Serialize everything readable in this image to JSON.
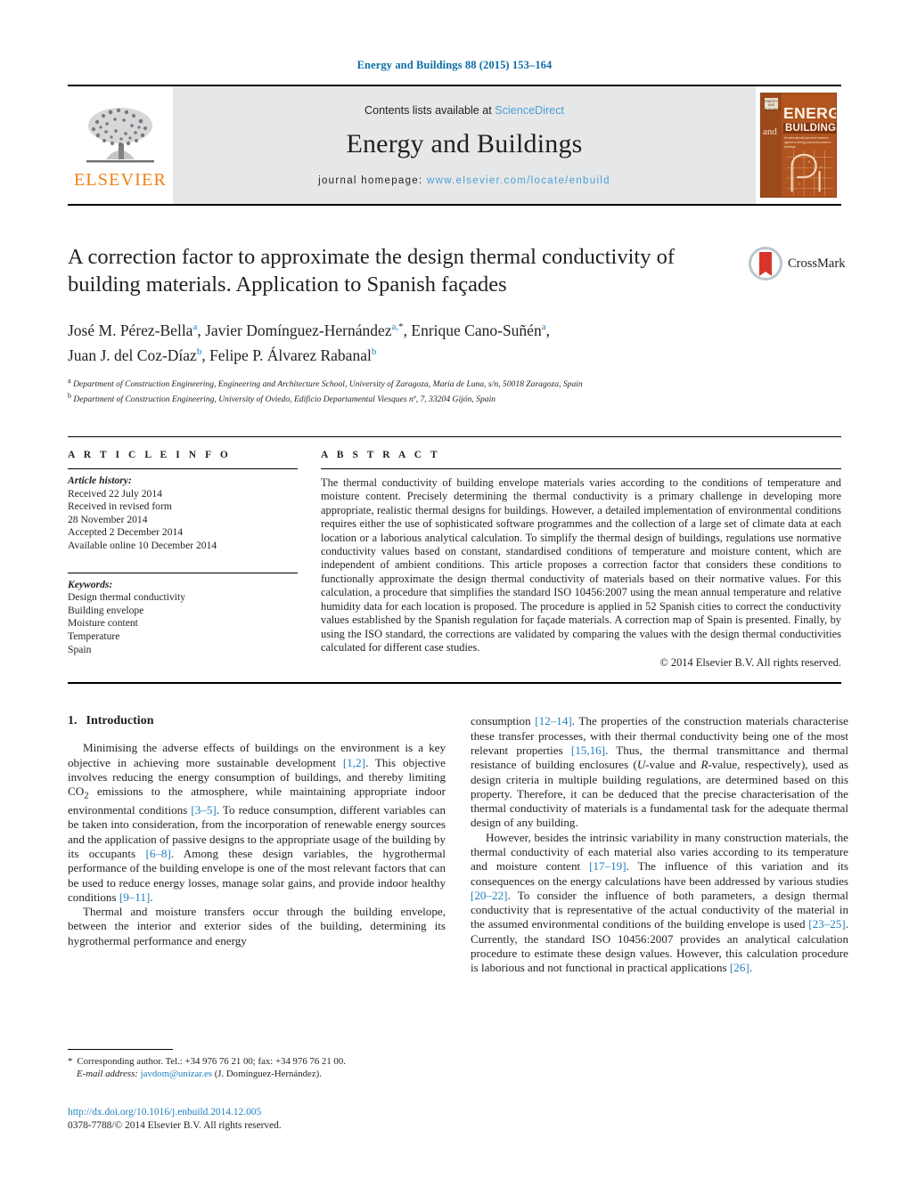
{
  "running_head": "Energy and Buildings 88 (2015) 153–164",
  "masthead": {
    "publisher_logo_text": "ELSEVIER",
    "contents_prefix": "Contents lists available at ",
    "contents_link": "ScienceDirect",
    "journal_title": "Energy and Buildings",
    "homepage_label": "journal homepage:",
    "homepage_url": "www.elsevier.com/locate/enbuild",
    "cover": {
      "badge": "ENERGY AND BUILDINGS",
      "word_and": "and",
      "word_energy": "ENERGY",
      "word_buildings": "BUILDINGS",
      "subtitle": "An international journal of research applied to energy and environment in buildings"
    }
  },
  "article": {
    "title": "A correction factor to approximate the design thermal conductivity of building materials. Application to Spanish façades",
    "crossmark_label": "CrossMark",
    "authors_line1_parts": [
      {
        "name": "José M. Pérez-Bella",
        "sup": "a",
        "sep": ", "
      },
      {
        "name": "Javier Domínguez-Hernández",
        "sup": "a,",
        "star": "*",
        "sep": ", "
      },
      {
        "name": "Enrique Cano-Suñén",
        "sup": "a",
        "sep": ","
      }
    ],
    "authors_line2_parts": [
      {
        "name": "Juan J. del Coz-Díaz",
        "sup": "b",
        "sep": ", "
      },
      {
        "name": "Felipe P. Álvarez Rabanal",
        "sup": "b",
        "sep": ""
      }
    ],
    "affiliations": [
      {
        "marker": "a",
        "text": "Department of Construction Engineering, Engineering and Architecture School, University of Zaragoza, María de Luna, s/n, 50018 Zaragoza, Spain"
      },
      {
        "marker": "b",
        "text": "Department of Construction Engineering, University of Oviedo, Edificio Departamental Viesques nº, 7, 33204 Gijón, Spain"
      }
    ]
  },
  "article_info": {
    "heading": "A R T I C L E   I N F O",
    "history_label": "Article history:",
    "history": [
      "Received 22 July 2014",
      "Received in revised form",
      "28 November 2014",
      "Accepted 2 December 2014",
      "Available online 10 December 2014"
    ],
    "keywords_label": "Keywords:",
    "keywords": [
      "Design thermal conductivity",
      "Building envelope",
      "Moisture content",
      "Temperature",
      "Spain"
    ]
  },
  "abstract": {
    "heading": "A B S T R A C T",
    "text": "The thermal conductivity of building envelope materials varies according to the conditions of temperature and moisture content. Precisely determining the thermal conductivity is a primary challenge in developing more appropriate, realistic thermal designs for buildings. However, a detailed implementation of environmental conditions requires either the use of sophisticated software programmes and the collection of a large set of climate data at each location or a laborious analytical calculation. To simplify the thermal design of buildings, regulations use normative conductivity values based on constant, standardised conditions of temperature and moisture content, which are independent of ambient conditions. This article proposes a correction factor that considers these conditions to functionally approximate the design thermal conductivity of materials based on their normative values. For this calculation, a procedure that simplifies the standard ISO 10456:2007 using the mean annual temperature and relative humidity data for each location is proposed. The procedure is applied in 52 Spanish cities to correct the conductivity values established by the Spanish regulation for façade materials. A correction map of Spain is presented. Finally, by using the ISO standard, the corrections are validated by comparing the values with the design thermal conductivities calculated for different case studies.",
    "copyright": "© 2014 Elsevier B.V. All rights reserved."
  },
  "section": {
    "number": "1.",
    "heading": "Introduction"
  },
  "body": {
    "left_p1_a": "Minimising the adverse effects of buildings on the environment is a key objective in achieving more sustainable development ",
    "left_p1_r1": "[1,2]",
    "left_p1_b": ". This objective involves reducing the energy consumption of buildings, and thereby limiting CO",
    "left_p1_sub": "2",
    "left_p1_c": " emissions to the atmosphere, while maintaining appropriate indoor environmental conditions ",
    "left_p1_r2": "[3–5]",
    "left_p1_d": ". To reduce consumption, different variables can be taken into consideration, from the incorporation of renewable energy sources and the application of passive designs to the appropriate usage of the building by its occupants ",
    "left_p1_r3": "[6–8]",
    "left_p1_e": ". Among these design variables, the hygrothermal performance of the building envelope is one of the most relevant factors that can be used to reduce energy losses, manage solar gains, and provide indoor healthy conditions ",
    "left_p1_r4": "[9–11]",
    "left_p1_f": ".",
    "left_p2_a": "Thermal and moisture transfers occur through the building envelope, between the interior and exterior sides of the building, determining its hygrothermal performance and energy",
    "right_p1_a": "consumption ",
    "right_p1_r1": "[12–14]",
    "right_p1_b": ". The properties of the construction materials characterise these transfer processes, with their thermal conductivity being one of the most relevant properties ",
    "right_p1_r2": "[15,16]",
    "right_p1_c": ". Thus, the thermal transmittance and thermal resistance of building enclosures (",
    "right_p1_i1": "U",
    "right_p1_d": "-value and ",
    "right_p1_i2": "R",
    "right_p1_e": "-value, respectively), used as design criteria in multiple building regulations, are determined based on this property. Therefore, it can be deduced that the precise characterisation of the thermal conductivity of materials is a fundamental task for the adequate thermal design of any building.",
    "right_p2_a": "However, besides the intrinsic variability in many construction materials, the thermal conductivity of each material also varies according to its temperature and moisture content ",
    "right_p2_r1": "[17–19]",
    "right_p2_b": ". The influence of this variation and its consequences on the energy calculations have been addressed by various studies ",
    "right_p2_r2": "[20–22]",
    "right_p2_c": ". To consider the influence of both parameters, a design thermal conductivity that is representative of the actual conductivity of the material in the assumed environmental conditions of the building envelope is used ",
    "right_p2_r3": "[23–25]",
    "right_p2_d": ". Currently, the standard ISO 10456:2007 provides an analytical calculation procedure to estimate these design values. However, this calculation procedure is laborious and not functional in practical applications ",
    "right_p2_r4": "[26]",
    "right_p2_e": "."
  },
  "footnote": {
    "star": "*",
    "corresponding": "Corresponding author. Tel.: +34 976 76 21 00; fax: +34 976 76 21 00.",
    "email_label": "E-mail address:",
    "email": "javdom@unizar.es",
    "email_owner": "(J. Domínguez-Hernández)."
  },
  "footer": {
    "doi": "http://dx.doi.org/10.1016/j.enbuild.2014.12.005",
    "issn_line": "0378-7788/© 2014 Elsevier B.V. All rights reserved."
  },
  "colors": {
    "link_blue": "#1f7fc0",
    "sciencedirect_blue": "#4c9fd7",
    "elsevier_orange": "#f07f13",
    "cover_orange": "#b1541f",
    "band_gray": "#e6e7e8"
  }
}
